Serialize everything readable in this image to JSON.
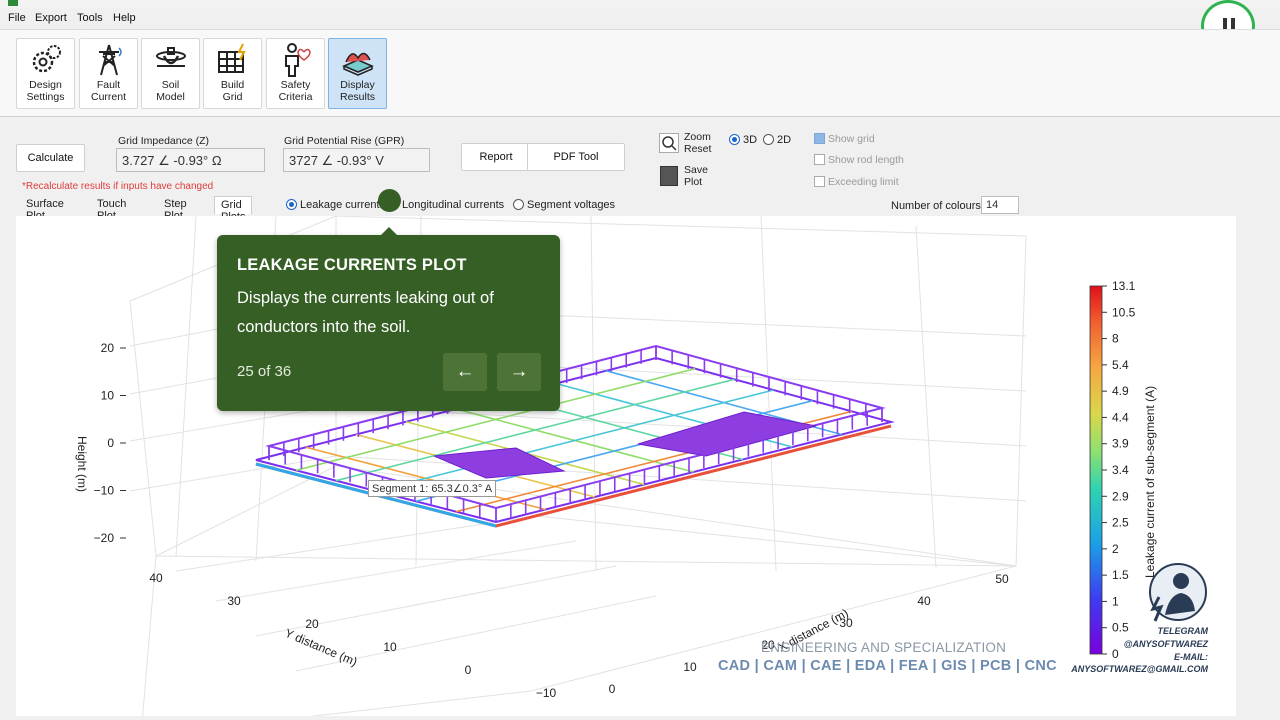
{
  "menu": [
    "File",
    "Export",
    "Tools",
    "Help"
  ],
  "ribbon": [
    {
      "label1": "Design",
      "label2": "Settings",
      "icon": "gears-icon"
    },
    {
      "label1": "Fault",
      "label2": "Current",
      "icon": "tower-icon"
    },
    {
      "label1": "Soil",
      "label2": "Model",
      "icon": "soil-icon"
    },
    {
      "label1": "Build",
      "label2": "Grid",
      "icon": "grid-icon"
    },
    {
      "label1": "Safety",
      "label2": "Criteria",
      "icon": "person-icon"
    },
    {
      "label1": "Display",
      "label2": "Results",
      "icon": "results-icon"
    }
  ],
  "toolbar": {
    "calculate": "Calculate",
    "impedance_label": "Grid Impedance (Z)",
    "impedance_value": "3.727 ∠ -0.93° Ω",
    "gpr_label": "Grid Potential Rise (GPR)",
    "gpr_value": "3727 ∠ -0.93° V",
    "report": "Report",
    "pdf": "PDF Tool",
    "zoom_reset1": "Zoom",
    "zoom_reset2": "Reset",
    "save_plot1": "Save",
    "save_plot2": "Plot",
    "view_3d": "3D",
    "view_2d": "2D",
    "show_grid": "Show grid",
    "show_rod": "Show rod length",
    "exceeding": "Exceeding limit",
    "warning": "*Recalculate results if inputs have changed",
    "num_colours_label": "Number of colours",
    "num_colours_value": "14"
  },
  "tabs": [
    "Surface Plot",
    "Touch Plot",
    "Step Plot",
    "Grid Plots"
  ],
  "plot_modes": [
    "Leakage currents",
    "Longitudinal currents",
    "Segment voltages"
  ],
  "tooltip": {
    "title": "LEAKAGE CURRENTS PLOT",
    "body": "Displays the currents leaking out of conductors into the soil.",
    "counter": "25 of 36",
    "prev": "←",
    "next": "→"
  },
  "chart_data": {
    "type": "3d-grid",
    "zlabel": "Height (m)",
    "ylabel": "Y distance (m)",
    "xlabel": "X distance (m)",
    "z_ticks": [
      "20",
      "10",
      "0",
      "−10",
      "−20"
    ],
    "y_ticks": [
      "40",
      "30",
      "20",
      "10",
      "0",
      "−10"
    ],
    "x_ticks": [
      "0",
      "10",
      "20",
      "30",
      "40",
      "50"
    ],
    "colorbar_label": "Leakage current of sub-segment (A)",
    "colorbar_ticks": [
      "13.1",
      "10.5",
      "8",
      "5.4",
      "4.9",
      "4.4",
      "3.9",
      "3.4",
      "2.9",
      "2.5",
      "2",
      "1.5",
      "1",
      "0.5",
      "0"
    ],
    "segment_label": "Segment 1: 65.3∠0.3° A"
  },
  "watermark": {
    "line1": "ENGINEERING AND SPECIALIZATION",
    "line2": "CAD | CAM | CAE | EDA | FEA | GIS | PCB | CNC",
    "telegram": "TELEGRAM",
    "handle": "@ANYSOFTWAREZ",
    "email_label": "E-MAIL:",
    "email": "ANYSOFTWAREZ@GMAIL.COM"
  },
  "colors": {
    "accent": "#355f24",
    "pause_ring": "#2eb34f"
  }
}
